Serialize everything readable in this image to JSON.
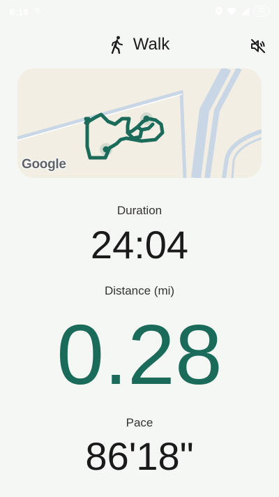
{
  "status_bar": {
    "time": "6:19",
    "signal_text": "⇅",
    "battery": "70"
  },
  "header": {
    "title": "Walk",
    "activity_icon": "walking-person-icon",
    "mute_icon": "volume-off-icon"
  },
  "map": {
    "attribution": "Google"
  },
  "stats": {
    "duration_label": "Duration",
    "duration_value": "24:04",
    "distance_label": "Distance (mi)",
    "distance_value": "0.28",
    "pace_label": "Pace",
    "pace_value": "86'18\""
  },
  "colors": {
    "background": "#f5f7f4",
    "route": "#1b6b5b",
    "distance_value": "#1b6b5b",
    "map_land": "#f2eee3",
    "map_road": "#c8d6e6"
  }
}
